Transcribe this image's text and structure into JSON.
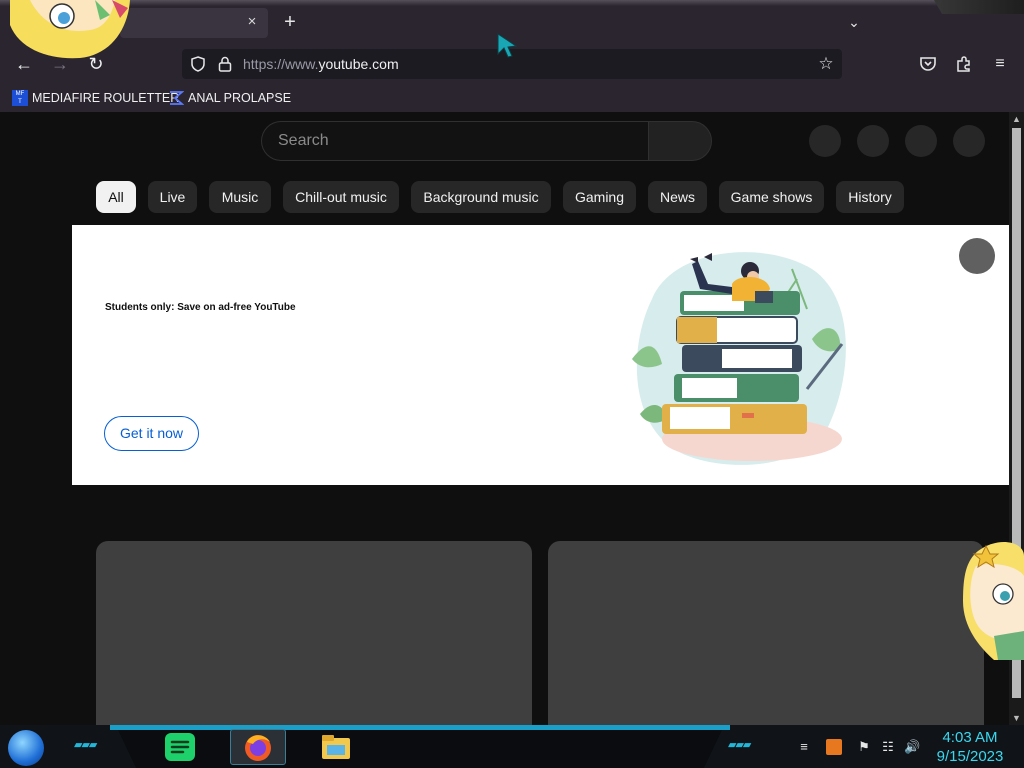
{
  "browser": {
    "tab_close": "×",
    "new_tab": "+",
    "url_prefix": "https://www.",
    "url_domain": "youtube.com",
    "bookmarks": [
      {
        "label": "MEDIAFIRE ROULETTER",
        "icon": "mediafire-icon"
      },
      {
        "label": "ANAL PROLAPSE",
        "icon": "sigma-icon"
      }
    ]
  },
  "youtube": {
    "search_placeholder": "Search",
    "chips": [
      "All",
      "Live",
      "Music",
      "Chill-out music",
      "Background music",
      "Gaming",
      "News",
      "Game shows",
      "History"
    ],
    "selected_chip": "All",
    "banner": {
      "headline": "Students only: Save on ad-free YouTube",
      "cta": "Get it now",
      "illustration": "student-reading-on-books-illustration"
    }
  },
  "taskbar": {
    "apps": [
      "spotify-icon",
      "firefox-icon",
      "file-explorer-icon"
    ],
    "active_app": "firefox-icon",
    "clock": {
      "time": "4:03 AM",
      "date": "9/15/2023"
    }
  },
  "colors": {
    "browser_chrome": "#2b2530",
    "page_bg": "#0f0f0f",
    "chip_bg": "#272727",
    "cta_blue": "#065fd4",
    "clock_cyan": "#38d8f0"
  }
}
